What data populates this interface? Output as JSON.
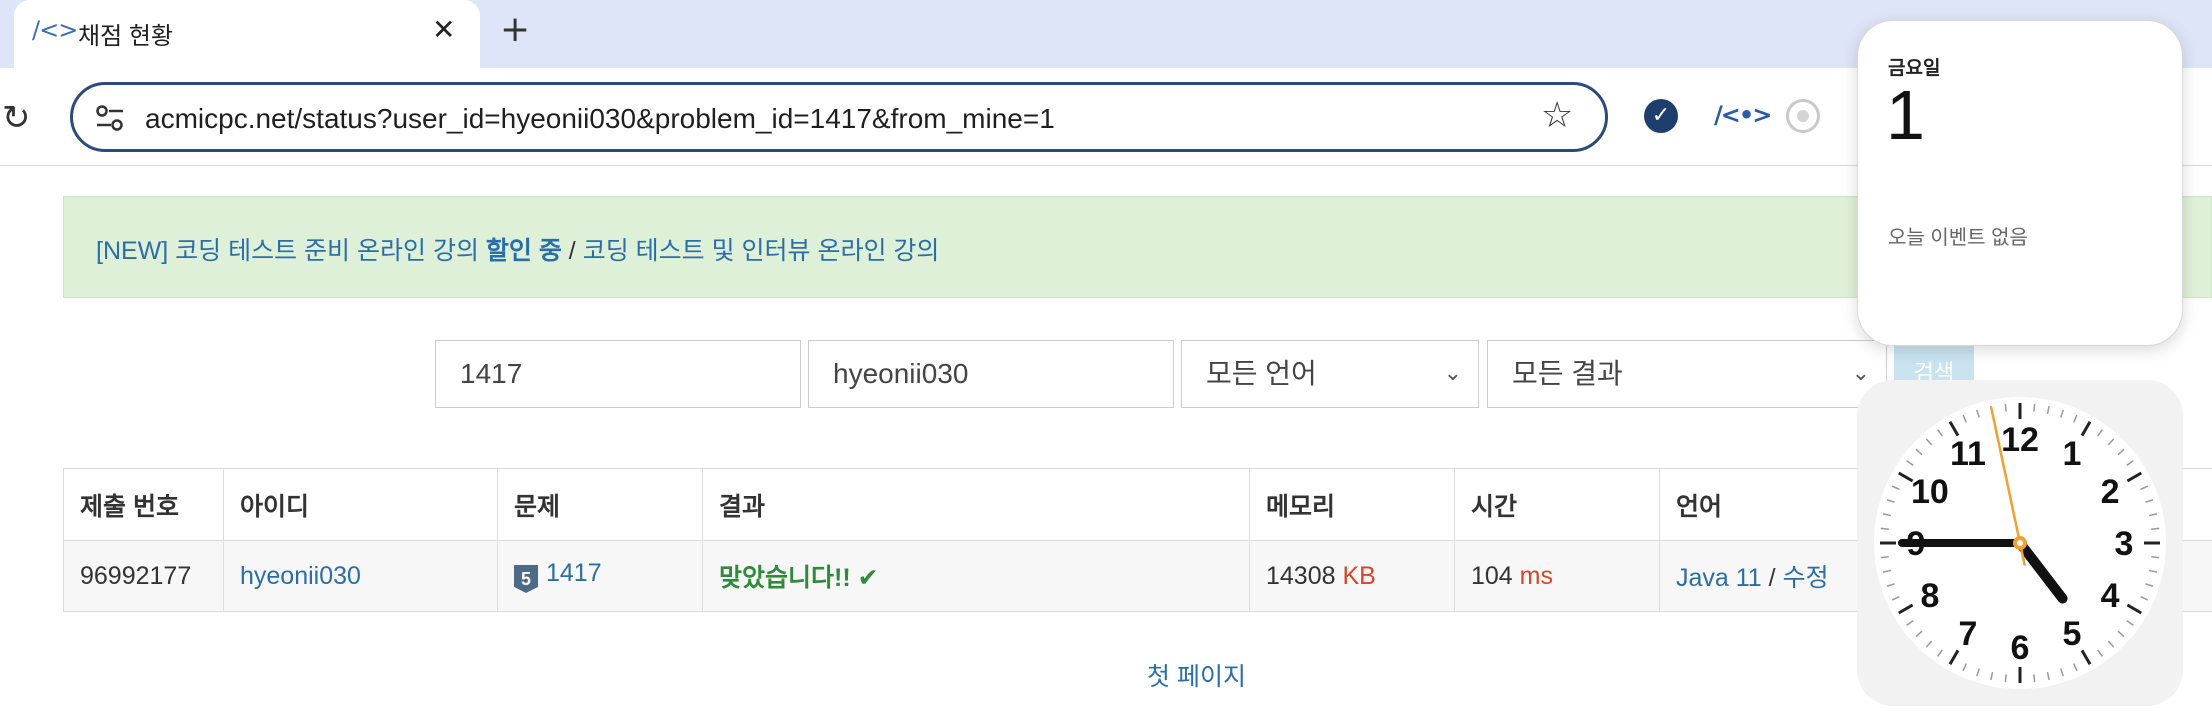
{
  "browser": {
    "tab": {
      "title": "채점 현황",
      "favicon": "/<>",
      "close": "✕"
    },
    "new_tab": "+",
    "url": "acmicpc.net/status?user_id=hyeonii030&problem_id=1417&from_mine=1",
    "icons": [
      "reload-icon",
      "site-settings-icon",
      "bookmark-star-icon",
      "check-extension-icon",
      "solvedac-extension-icon",
      "circle-extension-icon"
    ]
  },
  "banner": {
    "prefix": "[NEW] 코딩 테스트 준비 온라인 강의 ",
    "bold": "할인 중",
    "separator": " / ",
    "suffix": "코딩 테스트 및 인터뷰 온라인 강의"
  },
  "filters": {
    "problem_id": "1417",
    "user_id": "hyeonii030",
    "language": "모든 언어",
    "result": "모든 결과",
    "search_button": "검색"
  },
  "table": {
    "headers": [
      "제출 번호",
      "아이디",
      "문제",
      "결과",
      "메모리",
      "시간",
      "언어"
    ],
    "rows": [
      {
        "submission_id": "96992177",
        "user": "hyeonii030",
        "tier_badge": "5",
        "problem": "1417",
        "result": "맞았습니다!!",
        "result_mark": "✔",
        "memory": "14308",
        "memory_unit": "KB",
        "time": "104",
        "time_unit": "ms",
        "language": "Java 11",
        "lang_sep": " / ",
        "edit": "수정"
      }
    ]
  },
  "pagination": {
    "first_page": "첫 페이지"
  },
  "calendar_widget": {
    "weekday": "금요일",
    "day": "1",
    "empty_text": "오늘 이벤트 없음"
  },
  "clock_widget": {
    "numbers": [
      "12",
      "1",
      "2",
      "3",
      "4",
      "5",
      "6",
      "7",
      "8",
      "9",
      "10",
      "11"
    ],
    "hour": 4,
    "minute": 45,
    "second": 58
  },
  "colors": {
    "link": "#2a6ea8",
    "accepted": "#2e8b3a",
    "unit": "#d9442a",
    "banner_bg": "#dff0d8",
    "second_hand": "#f0a030"
  }
}
